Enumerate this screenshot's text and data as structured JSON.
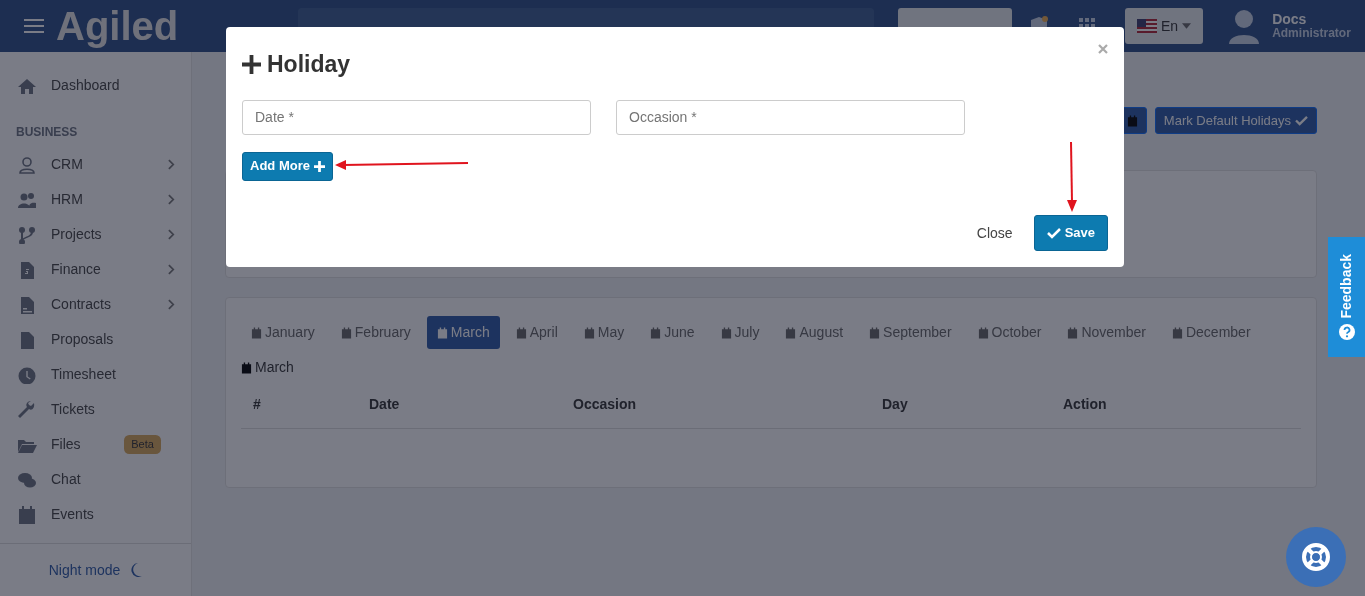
{
  "header": {
    "logo": "Agiled",
    "language": "En",
    "user": {
      "name": "Docs",
      "role": "Administrator"
    }
  },
  "sidebar": {
    "items": [
      {
        "kind": "link",
        "label": "Dashboard",
        "submenu": false
      },
      {
        "kind": "section",
        "label": "BUSINESS"
      },
      {
        "kind": "link",
        "label": "CRM",
        "submenu": true
      },
      {
        "kind": "link",
        "label": "HRM",
        "submenu": true
      },
      {
        "kind": "link",
        "label": "Projects",
        "submenu": true
      },
      {
        "kind": "link",
        "label": "Finance",
        "submenu": true
      },
      {
        "kind": "link",
        "label": "Contracts",
        "submenu": true
      },
      {
        "kind": "link",
        "label": "Proposals",
        "submenu": false
      },
      {
        "kind": "link",
        "label": "Timesheet",
        "submenu": false
      },
      {
        "kind": "link",
        "label": "Tickets",
        "submenu": false
      },
      {
        "kind": "link",
        "label": "Files",
        "submenu": false,
        "badge": "Beta"
      },
      {
        "kind": "link",
        "label": "Chat",
        "submenu": false
      },
      {
        "kind": "link",
        "label": "Events",
        "submenu": false
      }
    ],
    "night_mode": "Night mode"
  },
  "toolbar": {
    "mark_default_button": "Mark Default Holidays"
  },
  "months": [
    {
      "label": "January",
      "selected": false
    },
    {
      "label": "February",
      "selected": false
    },
    {
      "label": "March",
      "selected": true
    },
    {
      "label": "April",
      "selected": false
    },
    {
      "label": "May",
      "selected": false
    },
    {
      "label": "June",
      "selected": false
    },
    {
      "label": "July",
      "selected": false
    },
    {
      "label": "August",
      "selected": false
    },
    {
      "label": "September",
      "selected": false
    },
    {
      "label": "October",
      "selected": false
    },
    {
      "label": "November",
      "selected": false
    },
    {
      "label": "December",
      "selected": false
    }
  ],
  "section_title": "March",
  "table": {
    "columns": [
      "#",
      "Date",
      "Occasion",
      "Day",
      "Action"
    ]
  },
  "modal": {
    "title": "Holiday",
    "fields": [
      {
        "placeholder": "Date *"
      },
      {
        "placeholder": "Occasion *"
      }
    ],
    "add_more_button": "Add More",
    "close_button": "Close",
    "save_button": "Save"
  },
  "feedback_tab": "Feedback"
}
